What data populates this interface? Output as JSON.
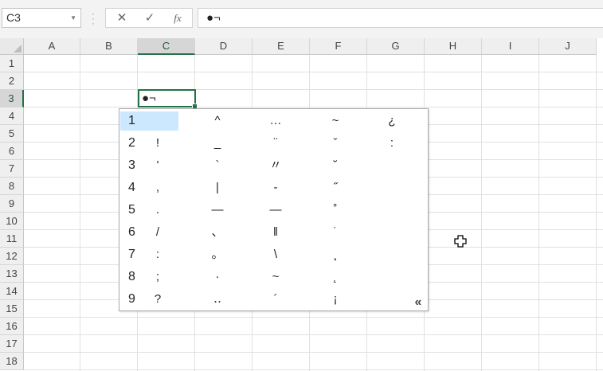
{
  "formula_bar": {
    "name_box": "C3",
    "cancel_icon": "✕",
    "enter_icon": "✓",
    "function_icon": "fx",
    "content": "●¬"
  },
  "columns": [
    "A",
    "B",
    "C",
    "D",
    "E",
    "F",
    "G",
    "H",
    "I",
    "J"
  ],
  "rows": [
    "1",
    "2",
    "3",
    "4",
    "5",
    "6",
    "7",
    "8",
    "9",
    "10",
    "11",
    "12",
    "13",
    "14",
    "15",
    "16",
    "17",
    "18"
  ],
  "selected_column": "C",
  "selected_row": "3",
  "active_cell": {
    "address": "C3",
    "value": "●¬"
  },
  "candidates": [
    {
      "number": "1",
      "symbols": [
        "",
        "^",
        "…",
        "~",
        "¿"
      ]
    },
    {
      "number": "2",
      "symbols": [
        "!",
        "_",
        "¨",
        "ˇ",
        ":"
      ]
    },
    {
      "number": "3",
      "symbols": [
        "'",
        "`",
        "〃",
        "˘",
        ""
      ]
    },
    {
      "number": "4",
      "symbols": [
        ",",
        "|",
        "-",
        "˝",
        ""
      ]
    },
    {
      "number": "5",
      "symbols": [
        ".",
        "—",
        "—",
        "˚",
        ""
      ]
    },
    {
      "number": "6",
      "symbols": [
        "/",
        "、",
        "‖",
        "˙",
        ""
      ]
    },
    {
      "number": "7",
      "symbols": [
        ":",
        "。",
        "\\",
        "¸",
        ""
      ]
    },
    {
      "number": "8",
      "symbols": [
        ";",
        "·",
        "~",
        "˛",
        ""
      ]
    },
    {
      "number": "9",
      "symbols": [
        "?",
        "‥",
        "´",
        "¡",
        ""
      ]
    }
  ],
  "expand_label": "«"
}
